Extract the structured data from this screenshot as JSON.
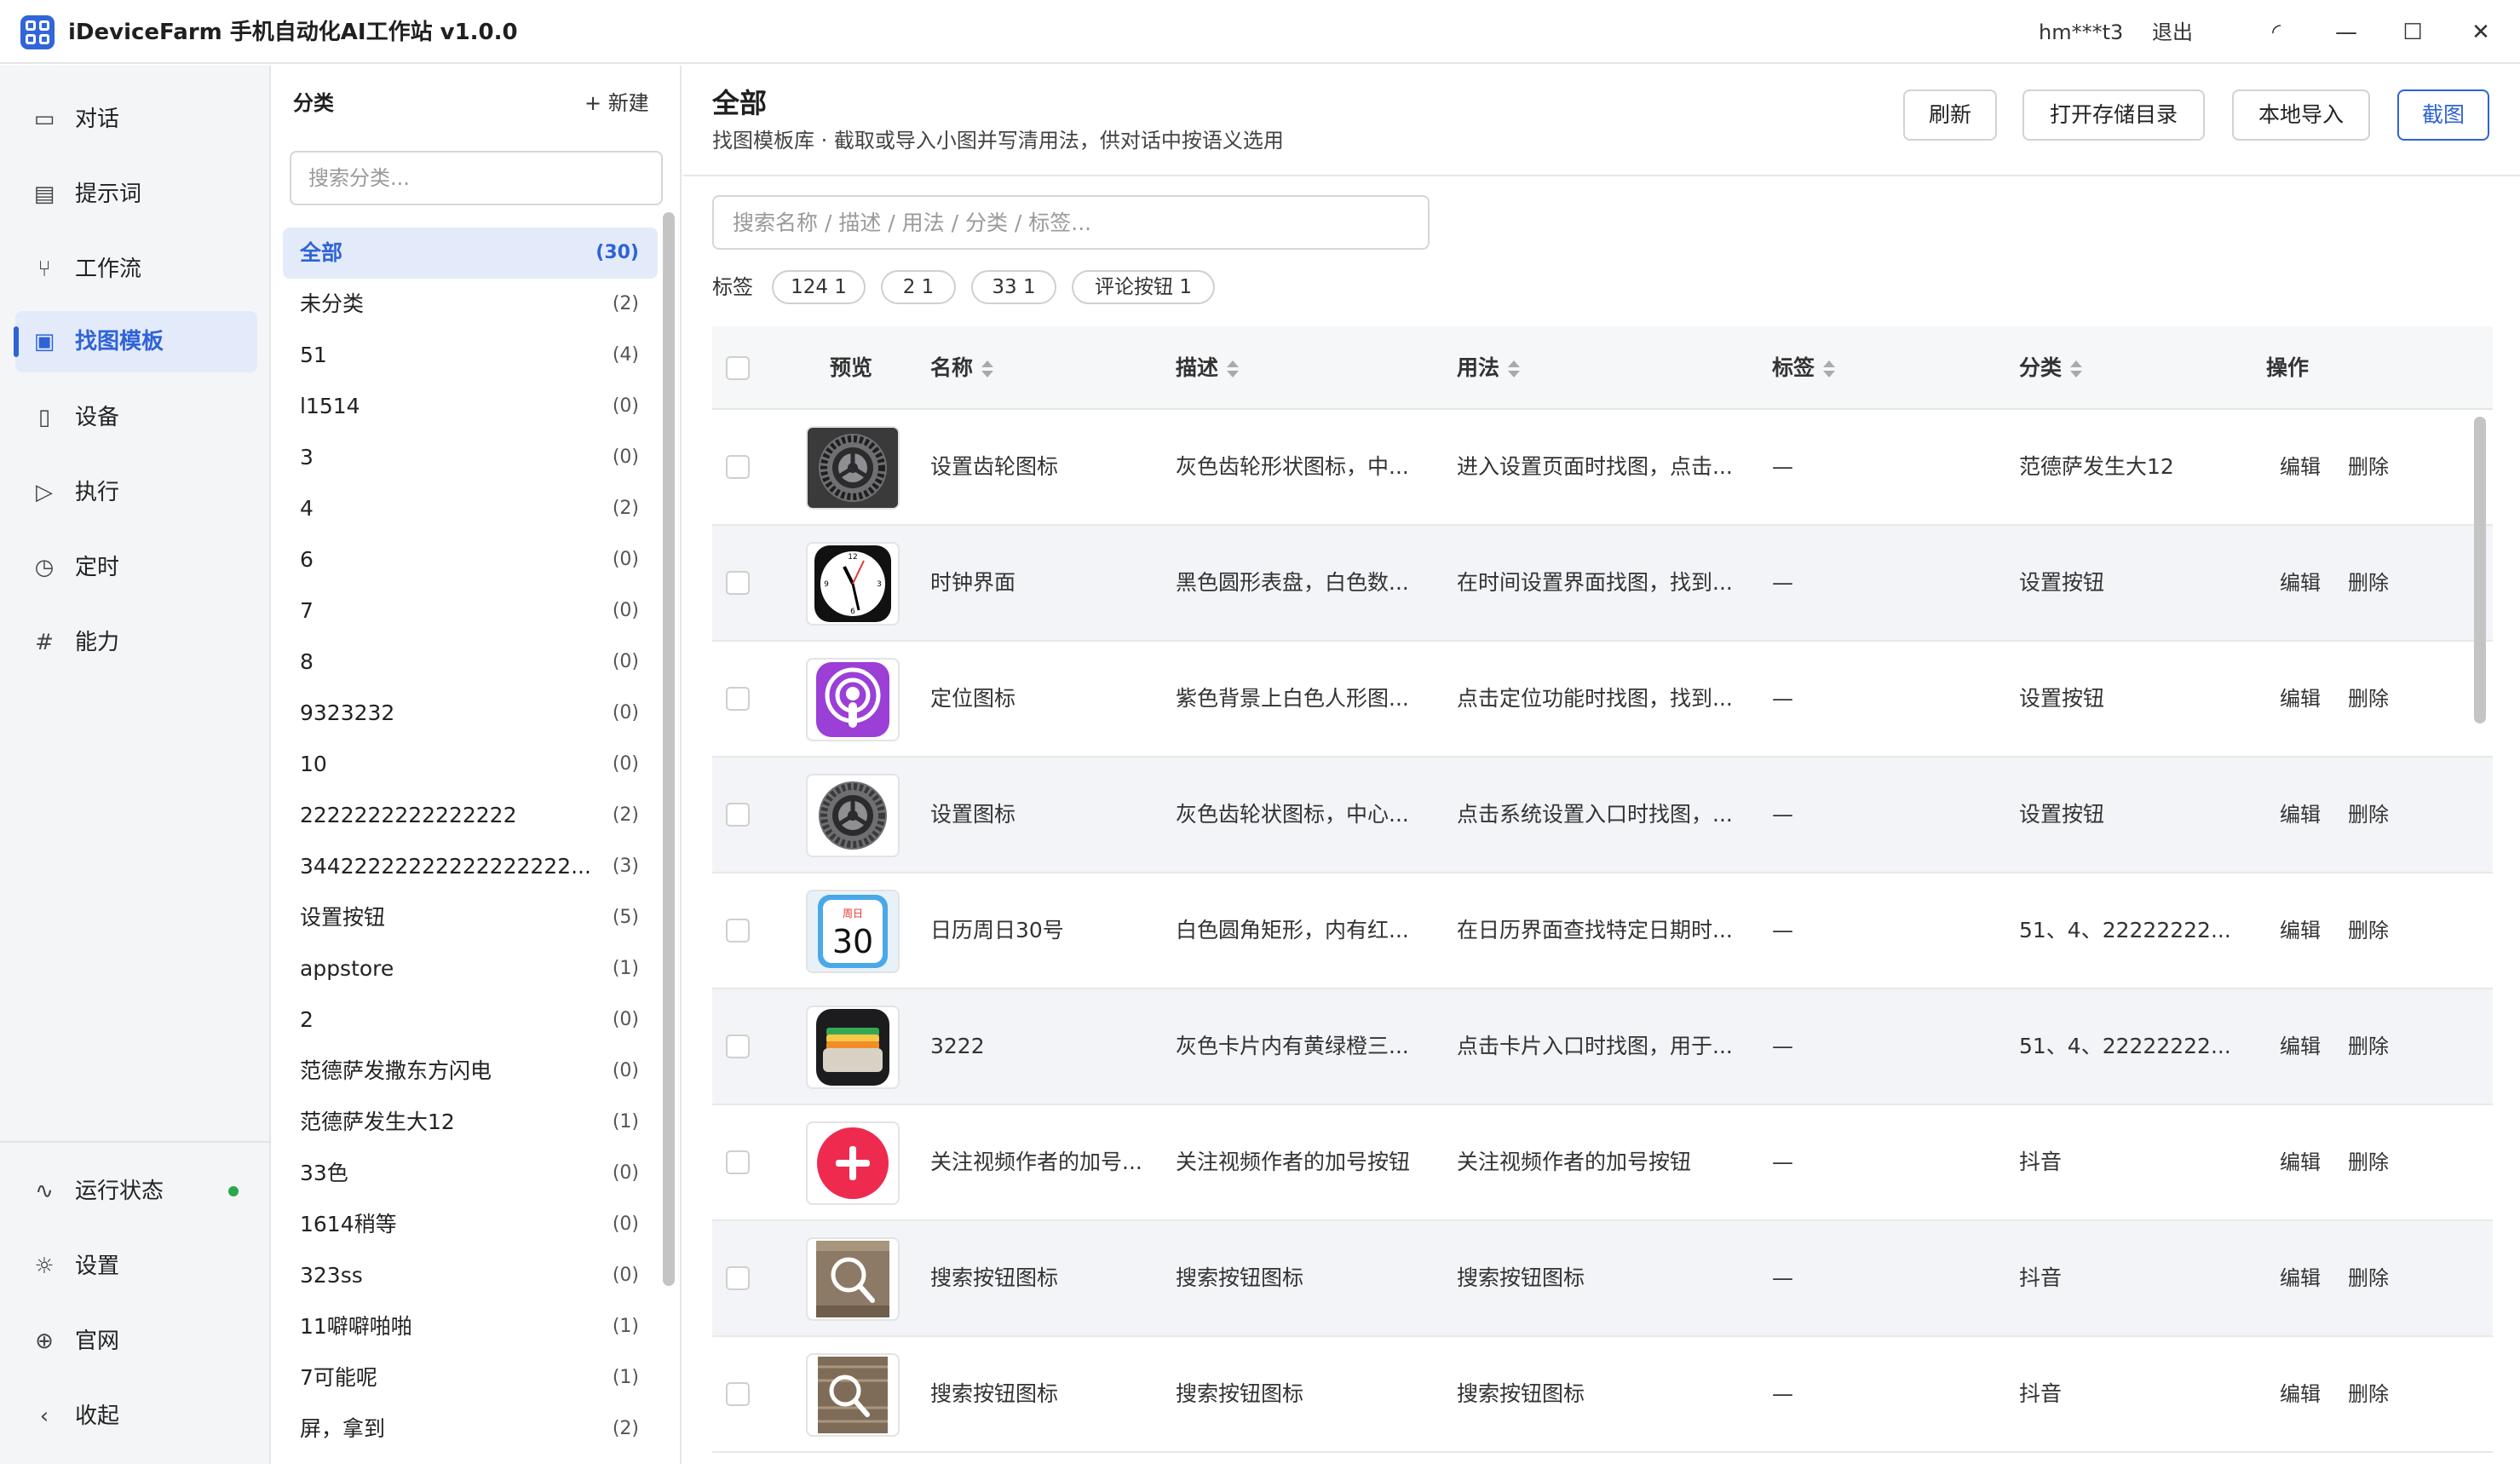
{
  "app": {
    "title": "iDeviceFarm 手机自动化AI工作站 v1.0.0",
    "user": "hm***t3",
    "logout": "退出"
  },
  "nav": {
    "items": [
      {
        "label": "对话",
        "icon": "chat-icon"
      },
      {
        "label": "提示词",
        "icon": "note-icon"
      },
      {
        "label": "工作流",
        "icon": "workflow-icon"
      },
      {
        "label": "找图模板",
        "icon": "image-icon"
      },
      {
        "label": "设备",
        "icon": "phone-icon"
      },
      {
        "label": "执行",
        "icon": "play-icon"
      },
      {
        "label": "定时",
        "icon": "clock-icon"
      },
      {
        "label": "能力",
        "icon": "hash-icon"
      }
    ],
    "bottom": [
      {
        "label": "运行状态",
        "icon": "activity-icon"
      },
      {
        "label": "设置",
        "icon": "gear-icon"
      },
      {
        "label": "官网",
        "icon": "globe-icon"
      },
      {
        "label": "收起",
        "icon": "chevron-left-icon"
      }
    ]
  },
  "categories": {
    "title": "分类",
    "new_label": "+ 新建",
    "search_placeholder": "搜索分类...",
    "items": [
      {
        "name": "全部",
        "count": "(30)"
      },
      {
        "name": "未分类",
        "count": "(2)"
      },
      {
        "name": "51",
        "count": "(4)"
      },
      {
        "name": "l1514",
        "count": "(0)"
      },
      {
        "name": "3",
        "count": "(0)"
      },
      {
        "name": "4",
        "count": "(2)"
      },
      {
        "name": "6",
        "count": "(0)"
      },
      {
        "name": "7",
        "count": "(0)"
      },
      {
        "name": "8",
        "count": "(0)"
      },
      {
        "name": "9323232",
        "count": "(0)"
      },
      {
        "name": "10",
        "count": "(0)"
      },
      {
        "name": "2222222222222222",
        "count": "(2)"
      },
      {
        "name": "34422222222222222222...",
        "count": "(3)"
      },
      {
        "name": "设置按钮",
        "count": "(5)"
      },
      {
        "name": "appstore",
        "count": "(1)"
      },
      {
        "name": "2",
        "count": "(0)"
      },
      {
        "name": "范德萨发撒东方闪电",
        "count": "(0)"
      },
      {
        "name": "范德萨发生大12",
        "count": "(1)"
      },
      {
        "name": "33色",
        "count": "(0)"
      },
      {
        "name": "1614稍等",
        "count": "(0)"
      },
      {
        "name": "323ss",
        "count": "(0)"
      },
      {
        "name": "11噼噼啪啪",
        "count": "(1)"
      },
      {
        "name": "7可能呢",
        "count": "(1)"
      },
      {
        "name": "屏，拿到",
        "count": "(2)"
      }
    ]
  },
  "main": {
    "title": "全部",
    "subtitle": "找图模板库 · 截取或导入小图并写清用法，供对话中按语义选用",
    "buttons": {
      "refresh": "刷新",
      "open_dir": "打开存储目录",
      "import": "本地导入",
      "capture": "截图"
    },
    "search_placeholder": "搜索名称 / 描述 / 用法 / 分类 / 标签...",
    "tag_label": "标签",
    "tags": [
      "124  1",
      "2  1",
      "33  1",
      "评论按钮  1"
    ],
    "columns": {
      "preview": "预览",
      "name": "名称",
      "desc": "描述",
      "usage": "用法",
      "tags": "标签",
      "category": "分类",
      "ops": "操作"
    },
    "edit": "编辑",
    "delete": "删除",
    "rows": [
      {
        "thumb": "gear-dark",
        "name": "设置齿轮图标",
        "desc": "灰色齿轮形状图标，中...",
        "usage": "进入设置页面时找图，点击...",
        "tags": "—",
        "category": "范德萨发生大12"
      },
      {
        "thumb": "clock",
        "name": "时钟界面",
        "desc": "黑色圆形表盘，白色数...",
        "usage": "在时间设置界面找图，找到...",
        "tags": "—",
        "category": "设置按钮"
      },
      {
        "thumb": "podcast",
        "name": "定位图标",
        "desc": "紫色背景上白色人形图...",
        "usage": "点击定位功能时找图，找到...",
        "tags": "—",
        "category": "设置按钮"
      },
      {
        "thumb": "gear-light",
        "name": "设置图标",
        "desc": "灰色齿轮状图标，中心...",
        "usage": "点击系统设置入口时找图，...",
        "tags": "—",
        "category": "设置按钮"
      },
      {
        "thumb": "calendar",
        "name": "日历周日30号",
        "desc": "白色圆角矩形，内有红...",
        "usage": "在日历界面查找特定日期时...",
        "tags": "—",
        "category": "51、4、22222222..."
      },
      {
        "thumb": "wallet",
        "name": "3222",
        "desc": "灰色卡片内有黄绿橙三...",
        "usage": "点击卡片入口时找图，用于...",
        "tags": "—",
        "category": "51、4、22222222..."
      },
      {
        "thumb": "plus",
        "name": "关注视频作者的加号...",
        "desc": "关注视频作者的加号按钮",
        "usage": "关注视频作者的加号按钮",
        "tags": "—",
        "category": "抖音"
      },
      {
        "thumb": "search",
        "name": "搜索按钮图标",
        "desc": "搜索按钮图标",
        "usage": "搜索按钮图标",
        "tags": "—",
        "category": "抖音"
      },
      {
        "thumb": "search2",
        "name": "搜索按钮图标",
        "desc": "搜索按钮图标",
        "usage": "搜索按钮图标",
        "tags": "—",
        "category": "抖音"
      }
    ],
    "calendar_thumb": {
      "weekday": "周日",
      "day": "30"
    }
  },
  "colors": {
    "accent": "#2f63d6",
    "nav_bg": "#f4f5f7",
    "active_bg": "#e3ebfb",
    "status_ok": "#2aa84a",
    "alt_row": "#f2f4f7"
  }
}
